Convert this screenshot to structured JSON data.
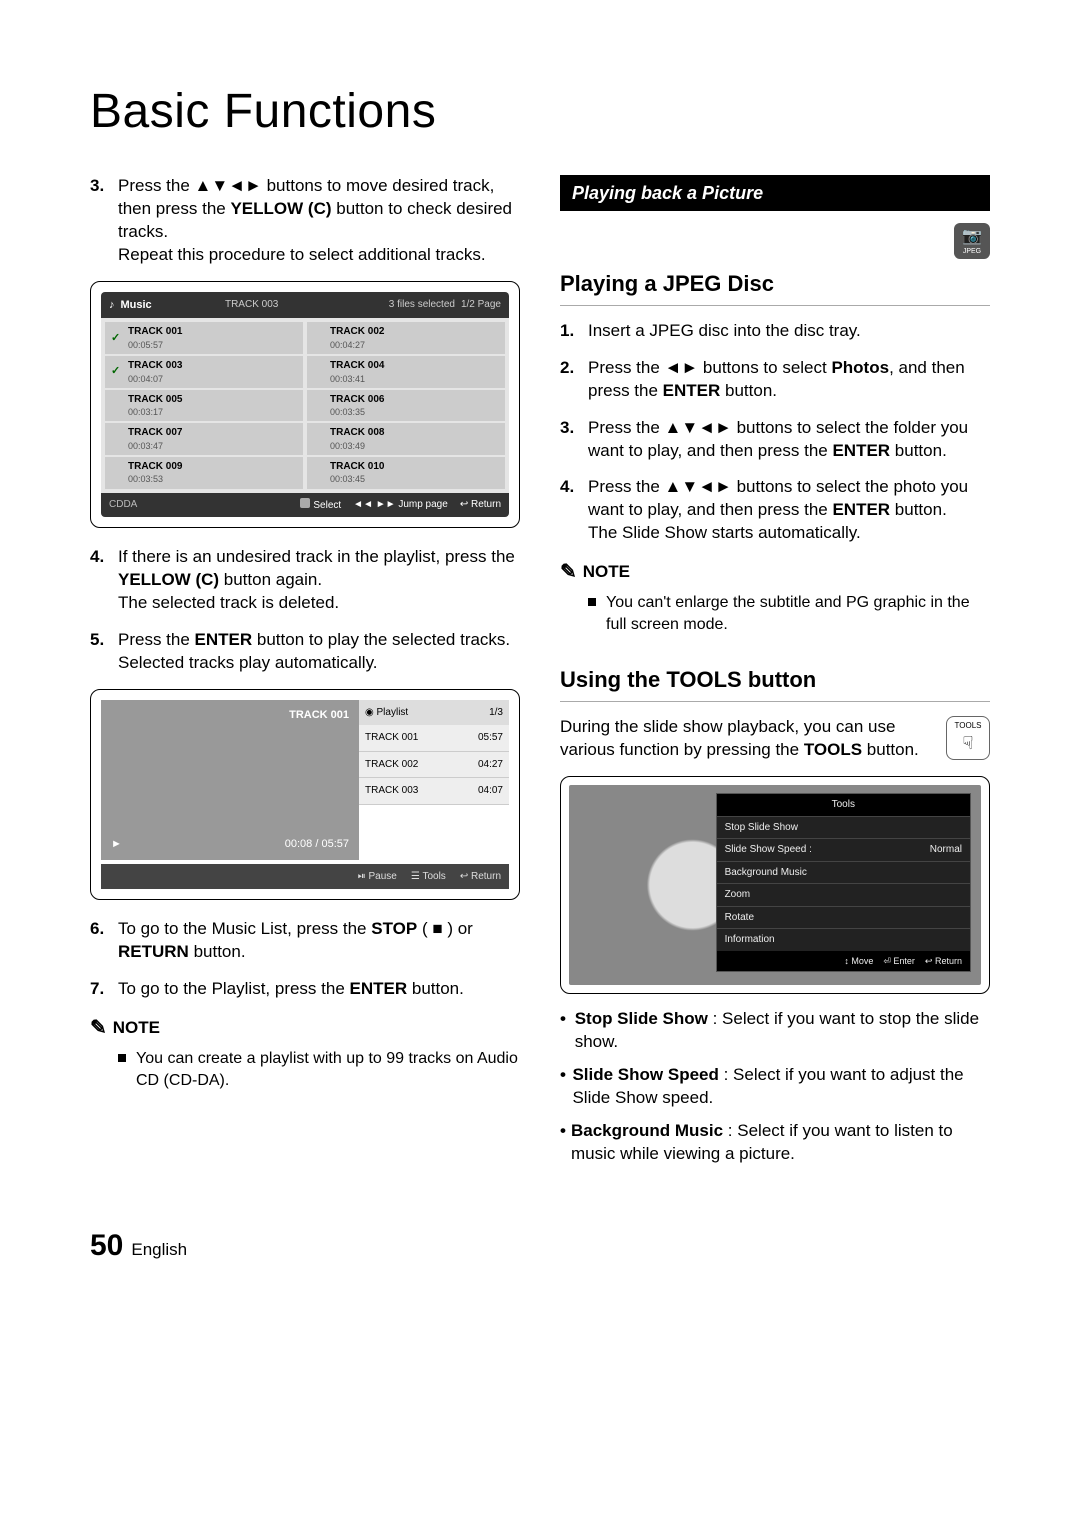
{
  "pageTitle": "Basic Functions",
  "left": {
    "step3": {
      "num": "3.",
      "a": "Press the ",
      "arrows": "▲▼◄►",
      "b": " buttons to move desired track, then press the ",
      "yellow": "YELLOW (C)",
      "c": " button to check desired tracks.",
      "d": "Repeat this procedure to select additional tracks."
    },
    "music": {
      "headerTitle": "Music",
      "headerSub": "TRACK 003",
      "sel": "3 files selected",
      "page": "1/2 Page",
      "tracks": [
        {
          "chk": "✓",
          "name": "TRACK 001",
          "dur": "00:05:57"
        },
        {
          "chk": "",
          "name": "TRACK 002",
          "dur": "00:04:27"
        },
        {
          "chk": "✓",
          "name": "TRACK 003",
          "dur": "00:04:07"
        },
        {
          "chk": "",
          "name": "TRACK 004",
          "dur": "00:03:41"
        },
        {
          "chk": "",
          "name": "TRACK 005",
          "dur": "00:03:17"
        },
        {
          "chk": "",
          "name": "TRACK 006",
          "dur": "00:03:35"
        },
        {
          "chk": "",
          "name": "TRACK 007",
          "dur": "00:03:47"
        },
        {
          "chk": "",
          "name": "TRACK 008",
          "dur": "00:03:49"
        },
        {
          "chk": "",
          "name": "TRACK 009",
          "dur": "00:03:53"
        },
        {
          "chk": "",
          "name": "TRACK 010",
          "dur": "00:03:45"
        }
      ],
      "footerL": "CDDA",
      "footerSelect": "Select",
      "footerJump": "Jump page",
      "footerReturn": "Return",
      "jumpIcon": "◄◄ ►►",
      "returnIcon": "↩"
    },
    "step4": {
      "num": "4.",
      "a": "If there is an undesired track in the playlist, press the ",
      "yellow": "YELLOW (C)",
      "b": " button again.",
      "c": "The selected track is deleted."
    },
    "step5": {
      "num": "5.",
      "a": "Press the ",
      "enter": "ENTER",
      "b": " button to play the selected tracks.",
      "c": "Selected tracks play automatically."
    },
    "playback": {
      "trackName": "TRACK 001",
      "time": "00:08 / 05:57",
      "playIcon": "►",
      "playlistLabel": "Playlist",
      "playlistIcon": "◉",
      "page": "1/3",
      "rows": [
        {
          "name": "TRACK 001",
          "dur": "05:57"
        },
        {
          "name": "TRACK 002",
          "dur": "04:27"
        },
        {
          "name": "TRACK 003",
          "dur": "04:07"
        }
      ],
      "pause": "Pause",
      "tools": "Tools",
      "return": "Return",
      "pauseIcon": "⏯",
      "toolsIcon": "☰",
      "returnIcon": "↩"
    },
    "step6": {
      "num": "6.",
      "a": "To go to the Music List, press the ",
      "stop": "STOP",
      "stopIcon": " ( ■ ) ",
      "b": "or ",
      "return": "RETURN",
      "c": " button."
    },
    "step7": {
      "num": "7.",
      "a": "To go to the Playlist, press the ",
      "enter": "ENTER",
      "b": " button."
    },
    "noteHead": "NOTE",
    "noteHand": "✎",
    "note": "You can create a playlist with up to 99 tracks on Audio CD (CD-DA)."
  },
  "right": {
    "sectionBar": "Playing back a Picture",
    "jpegBadge": "JPEG",
    "camIcon": "📷",
    "h2a": "Playing a JPEG Disc",
    "s1": {
      "num": "1.",
      "t": "Insert a JPEG disc into the disc tray."
    },
    "s2": {
      "num": "2.",
      "a": "Press the ",
      "arrows": "◄►",
      "b": " buttons to select ",
      "photos": "Photos",
      "c": ", and then press the ",
      "enter": "ENTER",
      "d": " button."
    },
    "s3": {
      "num": "3.",
      "a": "Press the ",
      "arrows": "▲▼◄►",
      "b": " buttons to select the folder you want to play, and then press the ",
      "enter": "ENTER",
      "c": " button."
    },
    "s4": {
      "num": "4.",
      "a": "Press the ",
      "arrows": "▲▼◄►",
      "b": " buttons to select the photo you want to play, and then press the ",
      "enter": "ENTER",
      "c": " button.",
      "d": "The Slide Show starts automatically."
    },
    "noteHead": "NOTE",
    "noteHand": "✎",
    "note": "You can't enlarge the subtitle and PG graphic in the full screen mode.",
    "h2b": "Using the TOOLS button",
    "toolsPara": {
      "a": "During the slide show playback, you can use various function by pressing the ",
      "tools": "TOOLS",
      "b": " button."
    },
    "toolsBadge": "TOOLS",
    "hand": "☟",
    "toolsPanel": {
      "title": "Tools",
      "rows": [
        {
          "l": "Stop Slide Show",
          "r": ""
        },
        {
          "l": "Slide Show Speed :",
          "r": "Normal"
        },
        {
          "l": "Background Music",
          "r": ""
        },
        {
          "l": "Zoom",
          "r": ""
        },
        {
          "l": "Rotate",
          "r": ""
        },
        {
          "l": "Information",
          "r": ""
        }
      ],
      "move": "Move",
      "enter": "Enter",
      "return": "Return",
      "moveIcon": "↕",
      "enterIcon": "⏎",
      "returnIcon": "↩"
    },
    "bullets": [
      {
        "b": "Stop Slide Show",
        "t": " : Select if you want to stop the slide show."
      },
      {
        "b": "Slide Show Speed",
        "t": " : Select if you want to adjust the Slide Show speed."
      },
      {
        "b": "Background Music",
        "t": " : Select if you want to listen to music while viewing a picture."
      }
    ]
  },
  "footer": {
    "num": "50",
    "lang": "English"
  }
}
